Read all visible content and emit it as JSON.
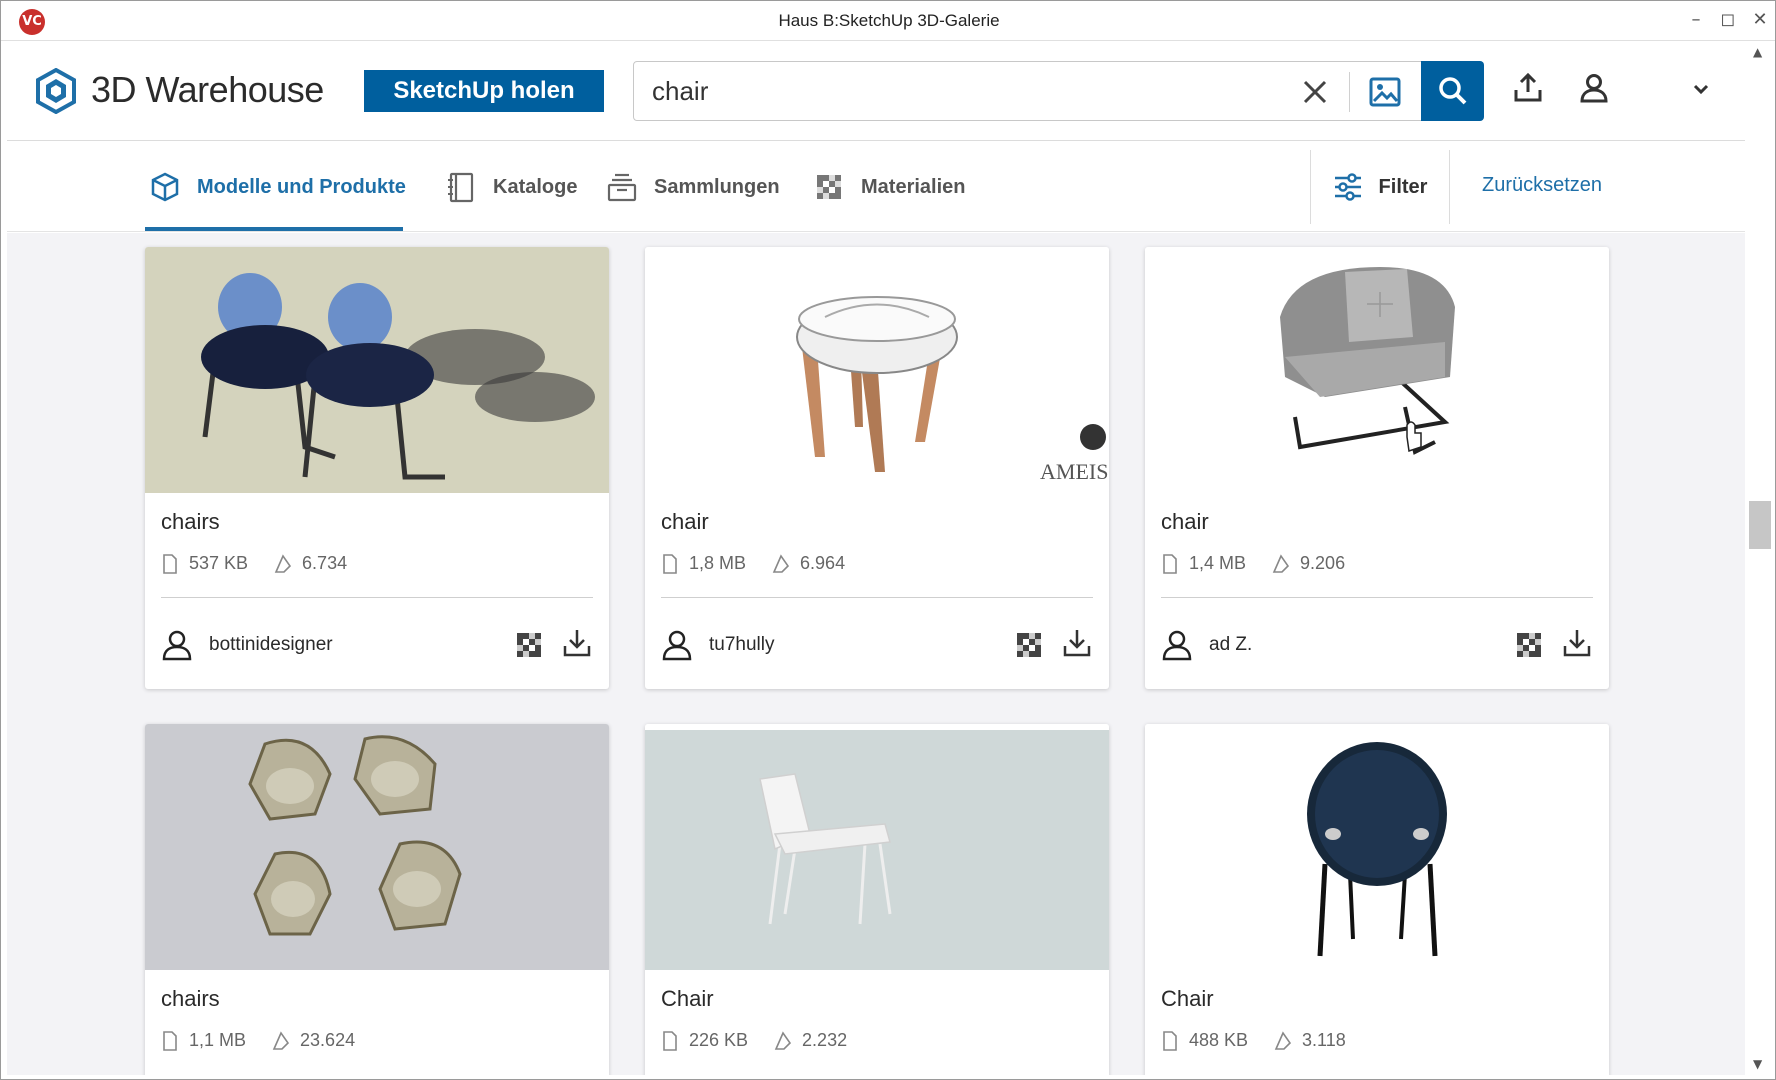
{
  "window": {
    "title": "Haus B:SketchUp 3D-Galerie",
    "app_icon_label": "VC",
    "controls": {
      "minimize": "–",
      "maximize": "◻",
      "close": "✕"
    }
  },
  "header": {
    "logo_text": "3D Warehouse",
    "get_button_label": "SketchUp holen",
    "search": {
      "value": "chair"
    }
  },
  "tabs": {
    "items": [
      {
        "label": "Modelle und Produkte",
        "icon": "cube-icon",
        "active": true
      },
      {
        "label": "Kataloge",
        "icon": "catalog-icon",
        "active": false
      },
      {
        "label": "Sammlungen",
        "icon": "collection-icon",
        "active": false
      },
      {
        "label": "Materialien",
        "icon": "material-icon",
        "active": false
      }
    ],
    "filter_label": "Filter",
    "reset_label": "Zurücksetzen"
  },
  "cards": [
    {
      "title": "chairs",
      "size": "537 KB",
      "likes": "6.734",
      "author": "bottinidesigner"
    },
    {
      "title": "chair",
      "size": "1,8 MB",
      "likes": "6.964",
      "author": "tu7hully",
      "watermark": "AMEISE design"
    },
    {
      "title": "chair",
      "size": "1,4 MB",
      "likes": "9.206",
      "author": "ad Z."
    },
    {
      "title": "chairs",
      "size": "1,1 MB",
      "likes": "23.624"
    },
    {
      "title": "Chair",
      "size": "226 KB",
      "likes": "2.232"
    },
    {
      "title": "Chair",
      "size": "488 KB",
      "likes": "3.118"
    }
  ],
  "colors": {
    "brand_blue": "#005f9e",
    "tab_active": "#1e6fa8",
    "content_bg": "#f3f3f6"
  }
}
